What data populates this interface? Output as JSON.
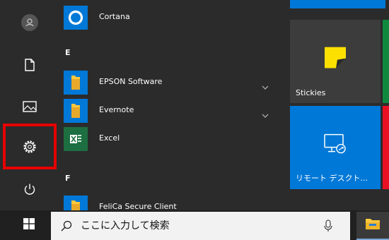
{
  "colors": {
    "accent": "#0078d7",
    "highlight": "#e60000",
    "excel": "#1d6f42",
    "folder": "#ffc83d",
    "background": "#2b2b2b",
    "taskbar": "#202020"
  },
  "rail": {
    "icons": [
      "user-avatar-icon",
      "document-icon",
      "pictures-icon",
      "settings-gear-icon",
      "power-icon"
    ],
    "highlighted_index": 3
  },
  "app_list": {
    "top_items": [
      {
        "label": "Cortana",
        "icon": "cortana-icon"
      }
    ],
    "groups": [
      {
        "letter": "E",
        "items": [
          {
            "label": "EPSON Software",
            "icon": "folder-icon",
            "expandable": true
          },
          {
            "label": "Evernote",
            "icon": "folder-icon",
            "expandable": true
          },
          {
            "label": "Excel",
            "icon": "excel-icon",
            "expandable": false
          }
        ]
      },
      {
        "letter": "F",
        "items": [
          {
            "label": "FeliCa Secure Client",
            "icon": "folder-icon",
            "expandable": true
          }
        ]
      }
    ]
  },
  "tiles": [
    {
      "label": "Stickies",
      "icon": "stickies-icon",
      "color": "#3c3c3c"
    },
    {
      "label": "リモート デスクト...",
      "icon": "remote-desktop-icon",
      "color": "#0078d7"
    }
  ],
  "partial_tiles": [
    {
      "color": "#0078d7"
    },
    {
      "color": "#10893e"
    },
    {
      "color": "#e81123"
    }
  ],
  "taskbar": {
    "start_icon": "windows-logo-icon",
    "search_icon": "search-icon",
    "search_placeholder": "ここに入力して検索",
    "mic_icon": "microphone-icon",
    "pinned": [
      {
        "icon": "file-explorer-icon"
      }
    ]
  }
}
